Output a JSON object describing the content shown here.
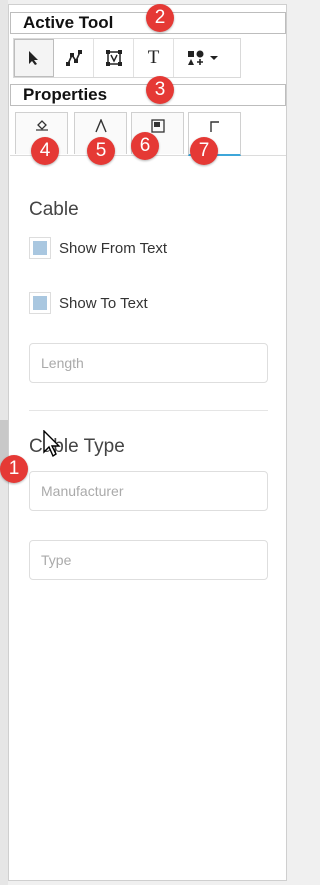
{
  "headers": {
    "active_tool": "Active Tool",
    "properties": "Properties"
  },
  "toolbar": {
    "tools": [
      {
        "name": "select-tool",
        "icon": "arrow-pointer-icon"
      },
      {
        "name": "node-edit-tool",
        "icon": "node-path-icon"
      },
      {
        "name": "transform-tool",
        "icon": "bounding-box-icon"
      },
      {
        "name": "text-tool",
        "icon": "text-T-icon",
        "glyph": "T"
      },
      {
        "name": "shapes-tool",
        "icon": "shapes-dropdown-icon"
      }
    ]
  },
  "tabs": [
    {
      "name": "fill",
      "icon": "paint-bucket-icon"
    },
    {
      "name": "text-style",
      "icon": "font-A-icon"
    },
    {
      "name": "image",
      "icon": "image-icon"
    },
    {
      "name": "cable",
      "icon": "cable-corner-icon",
      "active": true
    }
  ],
  "badges": [
    "1",
    "2",
    "3",
    "4",
    "5",
    "6",
    "7"
  ],
  "cable": {
    "title": "Cable",
    "show_from_text": "Show From Text",
    "show_to_text": "Show To Text",
    "length_placeholder": "Length"
  },
  "cable_type": {
    "title": "Cable Type",
    "manufacturer_placeholder": "Manufacturer",
    "type_placeholder": "Type"
  },
  "colors": {
    "badge": "#e53935",
    "active_tab_underline": "#3ea6d9",
    "checkbox_fill": "#a9c7e0"
  }
}
